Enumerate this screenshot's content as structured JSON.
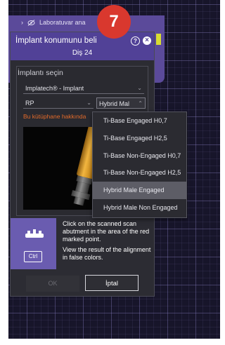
{
  "background": {
    "lab_header": "Laboratuvar ana"
  },
  "dialog": {
    "title": "İmplant konumunu beli",
    "subtitle": "Diş 24",
    "section_title": "İmplantı seçin",
    "manufacturer_value": "Implatech® - Implant",
    "platform_value": "RP",
    "type_value": "Hybrid Mal",
    "library_link": "Bu kütüphane hakkında",
    "dropdown_options": [
      "Ti-Base Engaged H0,7",
      "Ti-Base Engaged H2,5",
      "Ti-Base Non-Engaged H0,7",
      "Ti-Base Non-Engaged H2,5",
      "Hybrid Male Engaged",
      "Hybrid Male Non Engaged"
    ],
    "selected_index": 4,
    "instruction_1": "Click on the scanned scan abutment in the area of the red marked point.",
    "instruction_2": "View the result of the alignment in false colors.",
    "ctrl_key": "Ctrl",
    "ok_label": "OK",
    "cancel_label": "İptal"
  },
  "step_badge": "7",
  "colors": {
    "header_purple": "#514197",
    "link_orange": "#e46b2a",
    "badge_red": "#d9382e",
    "implant_gold": "#e0a030"
  }
}
